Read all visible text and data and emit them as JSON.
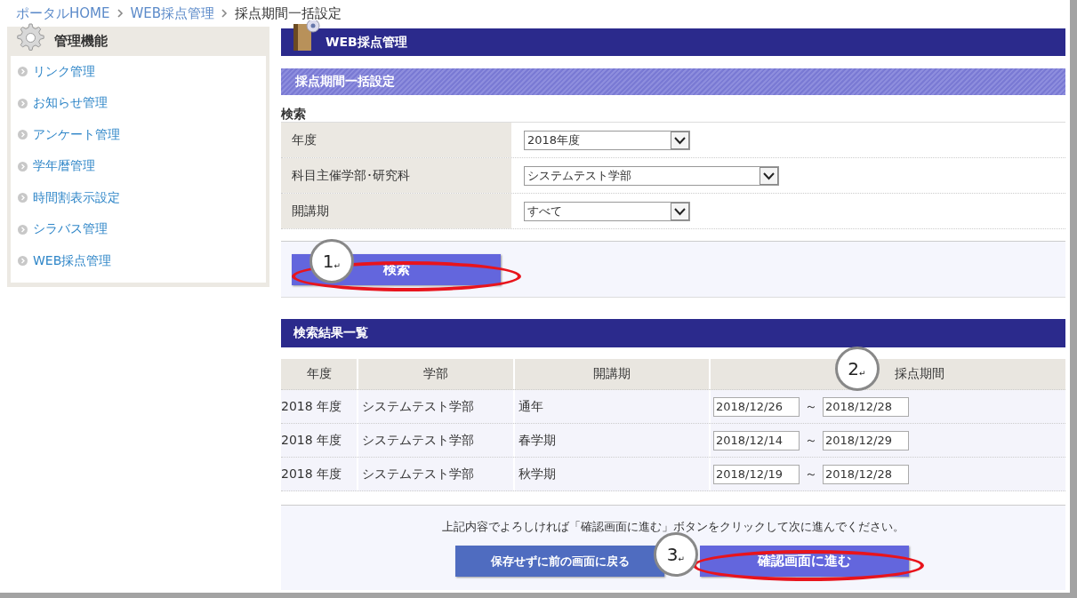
{
  "breadcrumb": [
    {
      "label": "ポータルHOME",
      "kind": "link"
    },
    {
      "label": "WEB採点管理",
      "kind": "link"
    },
    {
      "label": "採点期間一括設定",
      "kind": "current"
    }
  ],
  "sidebar": {
    "title": "管理機能",
    "items": [
      "リンク管理",
      "お知らせ管理",
      "アンケート管理",
      "学年暦管理",
      "時間割表示設定",
      "シラバス管理",
      "WEB採点管理"
    ]
  },
  "main": {
    "title": "WEB採点管理",
    "section_title": "採点期間一括設定",
    "search": {
      "heading": "検索",
      "fields": [
        {
          "label": "年度",
          "value": "2018年度"
        },
        {
          "label": "科目主催学部･研究科",
          "value": "システムテスト学部"
        },
        {
          "label": "開講期",
          "value": "すべて"
        }
      ],
      "button": {
        "label": "検索",
        "highlighted": true,
        "callout": {
          "number": "1",
          "mark": "↵"
        }
      }
    },
    "results": {
      "title": "検索結果一覧",
      "columns": [
        {
          "label": "年度"
        },
        {
          "label": "学部"
        },
        {
          "label": "開講期"
        },
        {
          "label": "採点期間",
          "callout": {
            "number": "2",
            "mark": "↵"
          }
        }
      ],
      "rows": [
        {
          "year": "2018 年度",
          "faculty": "システムテスト学部",
          "term": "通年",
          "start": "2018/12/26",
          "tilde": "～",
          "end": "2018/12/28"
        },
        {
          "year": "2018 年度",
          "faculty": "システムテスト学部",
          "term": "春学期",
          "start": "2018/12/14",
          "tilde": "～",
          "end": "2018/12/29"
        },
        {
          "year": "2018 年度",
          "faculty": "システムテスト学部",
          "term": "秋学期",
          "start": "2018/12/19",
          "tilde": "～",
          "end": "2018/12/28"
        }
      ]
    },
    "footer": {
      "message": "上記内容でよろしければ「確認画面に進む」ボタンをクリックして次に進んでください。",
      "buttons": [
        {
          "label": "保存せずに前の画面に戻る",
          "kind": "secondary",
          "highlighted": false
        },
        {
          "label": "確認画面に進む",
          "kind": "primary",
          "highlighted": true,
          "callout": {
            "number": "3",
            "mark": "↵"
          }
        }
      ]
    }
  }
}
